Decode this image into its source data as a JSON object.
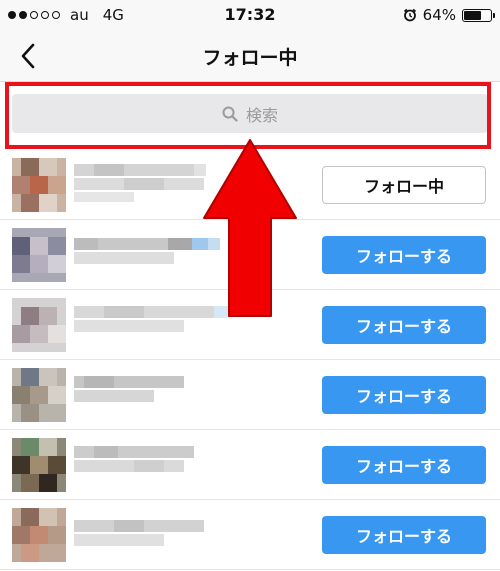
{
  "status_bar": {
    "carrier": "au",
    "network": "4G",
    "time": "17:32",
    "battery": "64%",
    "battery_level": 0.64
  },
  "nav": {
    "title": "フォロー中",
    "back_icon": "chevron-left-icon"
  },
  "search": {
    "placeholder": "検索",
    "icon": "search-icon"
  },
  "annotation": {
    "highlight_color": "#e8131d",
    "arrow_color": "#f00000"
  },
  "colors": {
    "accent": "#3897f0",
    "search_bg": "#e8e8ea"
  },
  "users": [
    {
      "button_label": "フォロー中",
      "button_style": "secondary"
    },
    {
      "button_label": "フォローする",
      "button_style": "primary"
    },
    {
      "button_label": "フォローする",
      "button_style": "primary"
    },
    {
      "button_label": "フォローする",
      "button_style": "primary"
    },
    {
      "button_label": "フォローする",
      "button_style": "primary"
    },
    {
      "button_label": "フォローする",
      "button_style": "primary"
    }
  ]
}
